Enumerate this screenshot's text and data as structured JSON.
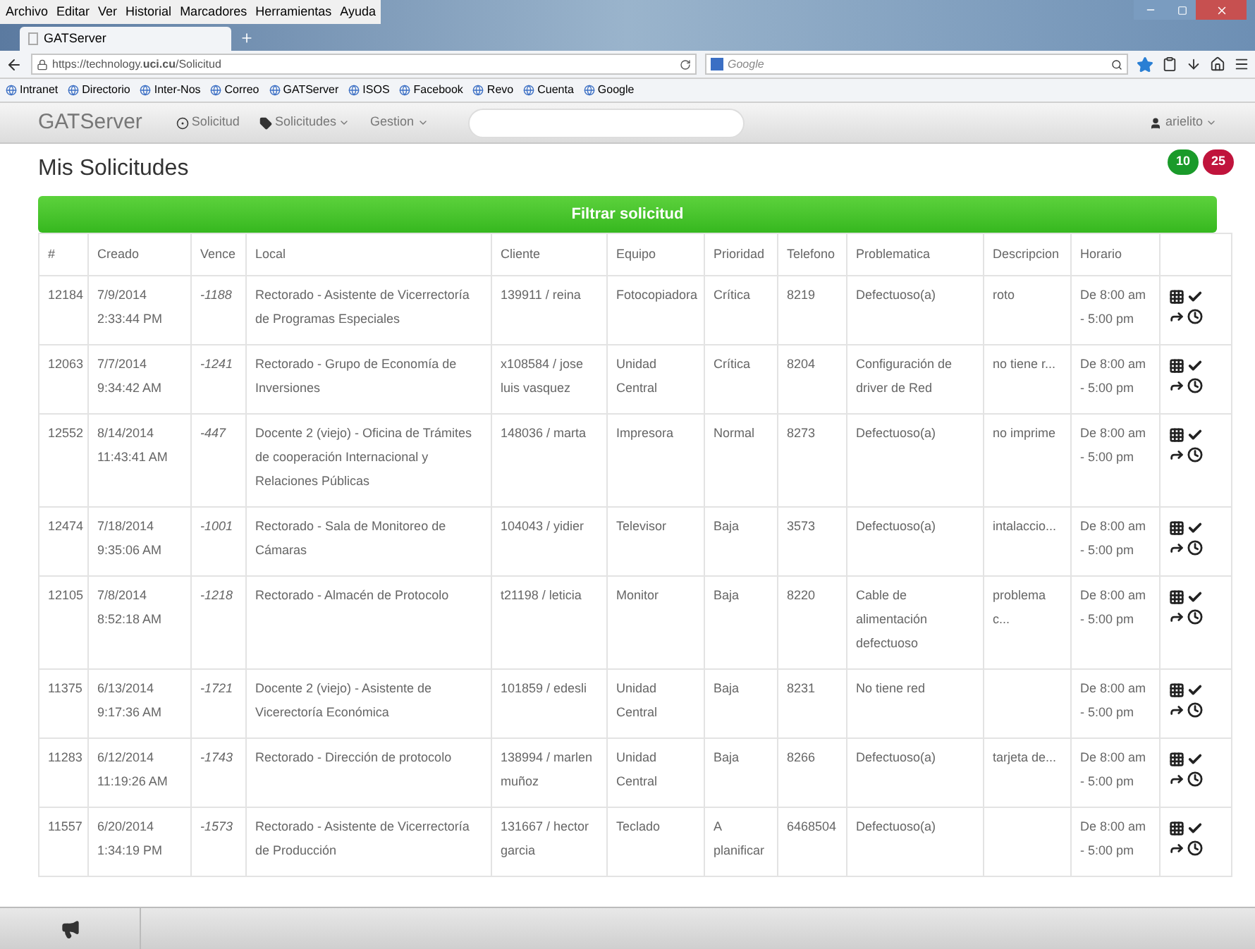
{
  "browser": {
    "menu": [
      "Archivo",
      "Editar",
      "Ver",
      "Historial",
      "Marcadores",
      "Herramientas",
      "Ayuda"
    ],
    "tabs": [
      {
        "label": "GATServer",
        "selected": true
      }
    ],
    "url": "https://technology.**uci.cu**/Solicitud",
    "search": {
      "placeholder": "Google"
    },
    "bookmarks": [
      "Intranet",
      "Directorio",
      "Inter-Nos",
      "Correo",
      "GATServer",
      "ISOS",
      "Facebook",
      "Revo",
      "Cuenta",
      "Google"
    ]
  },
  "navbar": {
    "brand": "GATServer",
    "items": [
      {
        "label": "Solicitud",
        "dropdown": false
      },
      {
        "label": "Solicitudes",
        "dropdown": true
      },
      {
        "label": "Gestion",
        "dropdown": true
      }
    ],
    "user": "arielito"
  },
  "page": {
    "title": "Mis Solicitudes",
    "badges": [
      {
        "label": "10",
        "color": "#1a9a2a"
      },
      {
        "label": "25",
        "color": "#c0143c"
      }
    ],
    "filter_button": "Filtrar solicitud"
  },
  "table": {
    "columns": [
      "#",
      "Creado",
      "Vence",
      "Local",
      "Cliente",
      "Equipo",
      "Prioridad",
      "Telefono",
      "Problematica",
      "Descripcion",
      "Horario"
    ],
    "rows": [
      {
        "id": "12184",
        "creado": "7/9/2014 2:33:44 PM",
        "vence": "-1188",
        "local": "Rectorado - Asistente de Vicerrectoría de Programas Especiales",
        "cliente": "139911 / reina",
        "equipo": "Fotocopiadora",
        "prioridad": "Crítica",
        "telefono": "8219",
        "problematica": "Defectuoso(a)",
        "descripcion": "roto",
        "horario": "De 8:00 am - 5:00 pm"
      },
      {
        "id": "12063",
        "creado": "7/7/2014 9:34:42 AM",
        "vence": "-1241",
        "local": "Rectorado - Grupo de Economía de Inversiones",
        "cliente": "x108584 / jose luis vasquez",
        "equipo": "Unidad Central",
        "prioridad": "Crítica",
        "telefono": "8204",
        "problematica": "Configuración de driver de Red",
        "descripcion": "no tiene r...",
        "horario": "De 8:00 am - 5:00 pm"
      },
      {
        "id": "12552",
        "creado": "8/14/2014 11:43:41 AM",
        "vence": "-447",
        "local": "Docente 2 (viejo) - Oficina de Trámites de cooperación Internacional y Relaciones Públicas",
        "cliente": "148036 / marta",
        "equipo": "Impresora",
        "prioridad": "Normal",
        "telefono": "8273",
        "problematica": "Defectuoso(a)",
        "descripcion": "no imprime",
        "horario": "De 8:00 am - 5:00 pm"
      },
      {
        "id": "12474",
        "creado": "7/18/2014 9:35:06 AM",
        "vence": "-1001",
        "local": "Rectorado - Sala de Monitoreo de Cámaras",
        "cliente": "104043 / yidier",
        "equipo": "Televisor",
        "prioridad": "Baja",
        "telefono": "3573",
        "problematica": "Defectuoso(a)",
        "descripcion": "intalaccio...",
        "horario": "De 8:00 am - 5:00 pm"
      },
      {
        "id": "12105",
        "creado": "7/8/2014 8:52:18 AM",
        "vence": "-1218",
        "local": "Rectorado - Almacén de Protocolo",
        "cliente": "t21198 / leticia",
        "equipo": "Monitor",
        "prioridad": "Baja",
        "telefono": "8220",
        "problematica": "Cable de alimentación defectuoso",
        "descripcion": "problema c...",
        "horario": "De 8:00 am - 5:00 pm"
      },
      {
        "id": "11375",
        "creado": "6/13/2014 9:17:36 AM",
        "vence": "-1721",
        "local": "Docente 2 (viejo) - Asistente de Vicerectoría Económica",
        "cliente": "101859 / edesli",
        "equipo": "Unidad Central",
        "prioridad": "Baja",
        "telefono": "8231",
        "problematica": "No tiene red",
        "horario": "De 8:00 am - 5:00 pm"
      },
      {
        "id": "11283",
        "creado": "6/12/2014 11:19:26 AM",
        "vence": "-1743",
        "local": "Rectorado - Dirección de protocolo",
        "cliente": "138994 / marlen muñoz",
        "equipo": "Unidad Central",
        "prioridad": "Baja",
        "telefono": "8266",
        "problematica": "Defectuoso(a)",
        "descripcion": "tarjeta de...",
        "horario": "De 8:00 am - 5:00 pm"
      },
      {
        "id": "11557",
        "creado": "6/20/2014 1:34:19 PM",
        "vence": "-1573",
        "local": "Rectorado - Asistente de Vicerrectoría de Producción",
        "cliente": "131667 / hector garcia",
        "equipo": "Teclado",
        "prioridad": "A planificar",
        "telefono": "6468504",
        "problematica": "Defectuoso(a)",
        "horario": "De 8:00 am - 5:00 pm"
      }
    ]
  }
}
